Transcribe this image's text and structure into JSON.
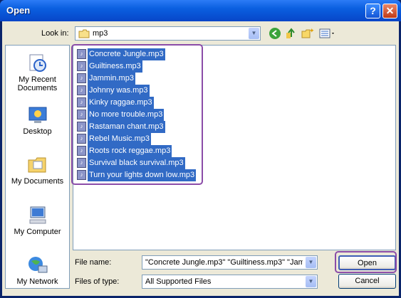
{
  "window": {
    "title": "Open"
  },
  "look_in": {
    "label": "Look in:",
    "value": "mp3"
  },
  "places": [
    {
      "label": "My Recent Documents",
      "icon": "recent-documents-icon"
    },
    {
      "label": "Desktop",
      "icon": "desktop-icon"
    },
    {
      "label": "My Documents",
      "icon": "my-documents-icon"
    },
    {
      "label": "My Computer",
      "icon": "my-computer-icon"
    },
    {
      "label": "My Network",
      "icon": "my-network-icon"
    }
  ],
  "files": [
    "Concrete Jungle.mp3",
    "Guiltiness.mp3",
    "Jammin.mp3",
    "Johnny was.mp3",
    "Kinky raggae.mp3",
    "No more trouble.mp3",
    "Rastaman chant.mp3",
    "Rebel Music.mp3",
    "Roots rock reggae.mp3",
    "Survival black survival.mp3",
    "Turn your lights down low.mp3"
  ],
  "file_name": {
    "label": "File name:",
    "value": "\"Concrete Jungle.mp3\" \"Guiltiness.mp3\" \"Jam"
  },
  "files_of_type": {
    "label": "Files of type:",
    "value": "All Supported Files"
  },
  "buttons": {
    "open": "Open",
    "cancel": "Cancel"
  },
  "colors": {
    "selection": "#316AC5",
    "highlight_outline": "#8B4CA8",
    "titlebar": "#0A5FE0"
  }
}
